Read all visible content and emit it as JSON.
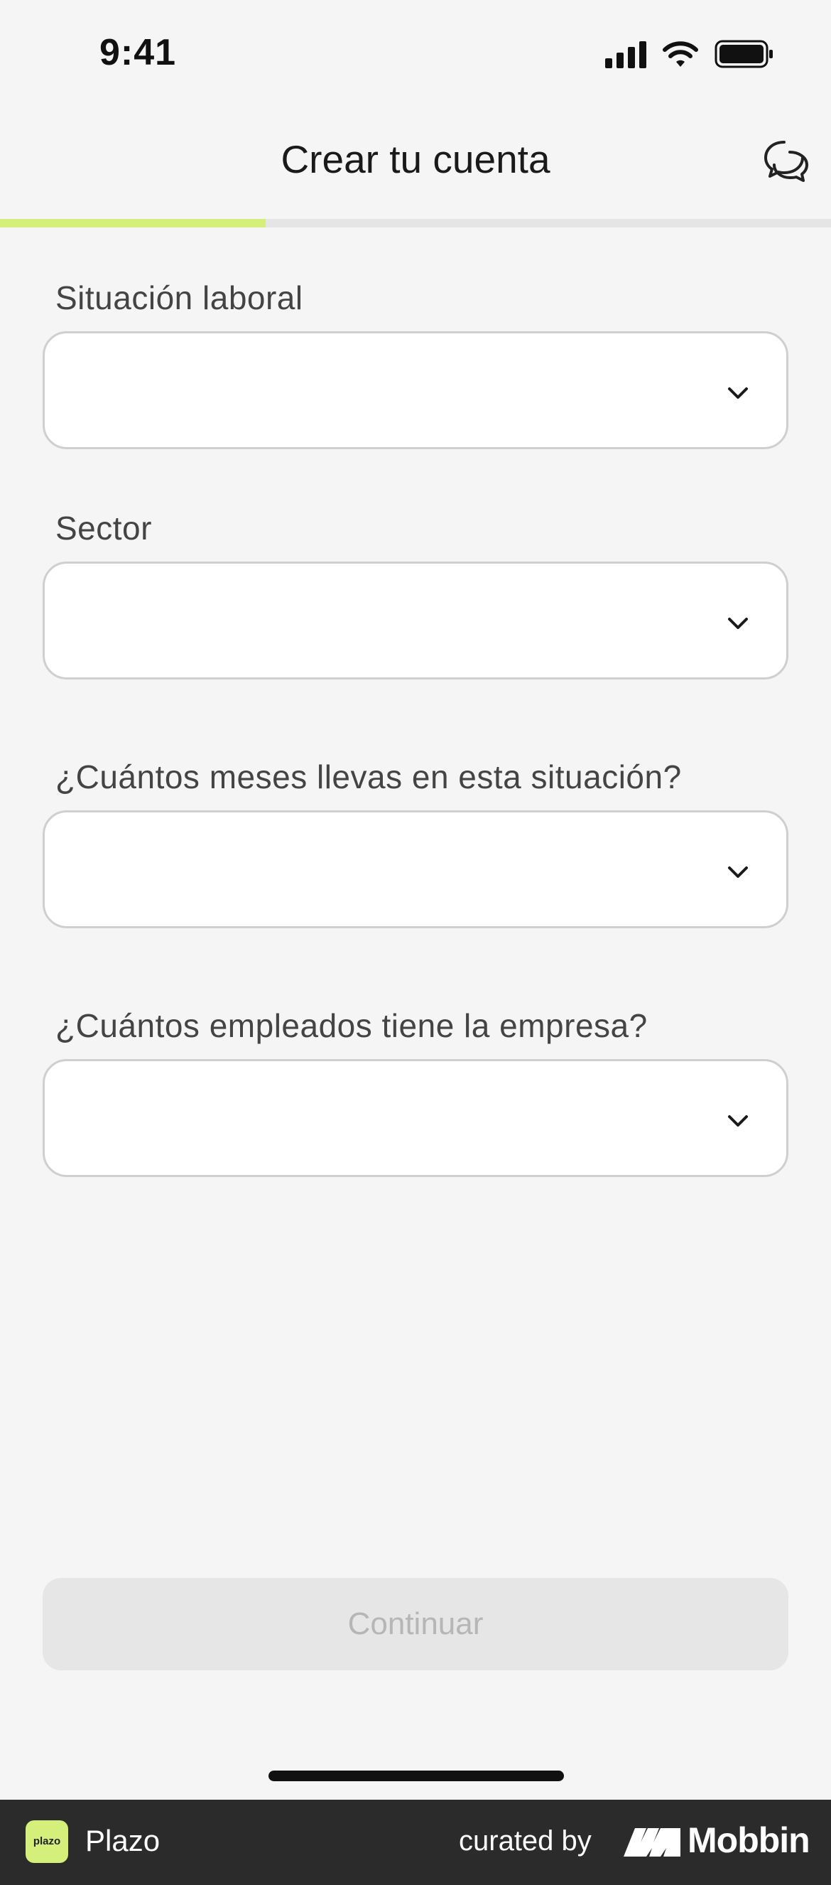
{
  "status_bar": {
    "time": "9:41"
  },
  "header": {
    "title": "Crear tu cuenta",
    "chat_icon": "chat-bubbles-icon"
  },
  "progress": {
    "fraction": 0.32,
    "fill_color": "#d4f07a"
  },
  "fields": [
    {
      "label": "Situación laboral",
      "value": ""
    },
    {
      "label": "Sector",
      "value": ""
    },
    {
      "label": "¿Cuántos meses llevas en esta situación?",
      "value": ""
    },
    {
      "label": "¿Cuántos empleados tiene la empresa?",
      "value": ""
    }
  ],
  "continue_button": {
    "label": "Continuar",
    "enabled": false
  },
  "footer": {
    "app_name": "Plazo",
    "logo_text": "plazo",
    "curated_by": "curated by",
    "brand": "Mobbin"
  }
}
